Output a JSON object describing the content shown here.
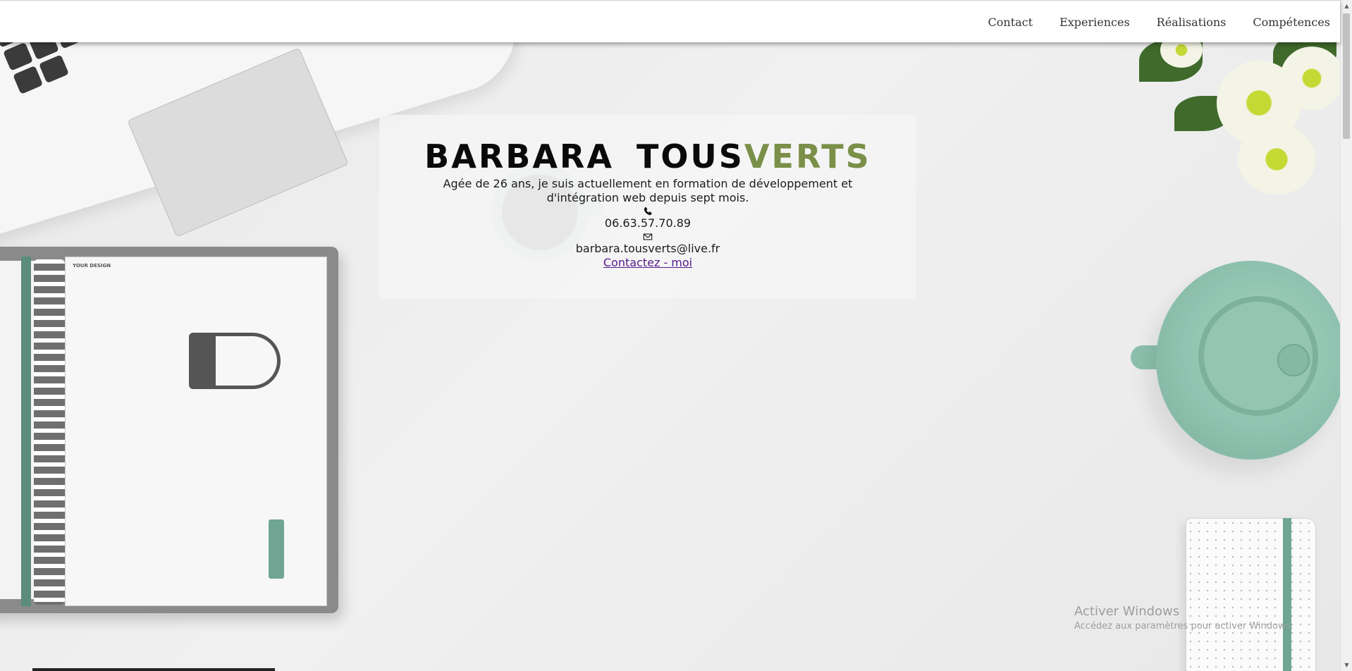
{
  "nav": {
    "items": [
      "Contact",
      "Experiences",
      "Réalisations",
      "Compétences"
    ]
  },
  "hero": {
    "first_name": "BARBARA",
    "last_name_part1": "TOUS",
    "last_name_part2": "VERTS",
    "description": "Agée de 26 ans, je suis actuellement en formation de développement et d'intégration web depuis sept mois.",
    "phone_icon": "phone-icon",
    "phone": "06.63.57.70.89",
    "email_icon": "envelope-icon",
    "email": "barbara.tousverts@live.fr",
    "contact_link": "Contactez - moi"
  },
  "background": {
    "notebook_label": "YOUR DESIGN"
  },
  "watermark": {
    "title": "Activer Windows",
    "subtitle": "Accédez aux paramètres pour activer Windows."
  },
  "colors": {
    "accent": "#7a8f48",
    "link": "#551a8b",
    "teal": "#8cc0ad"
  }
}
